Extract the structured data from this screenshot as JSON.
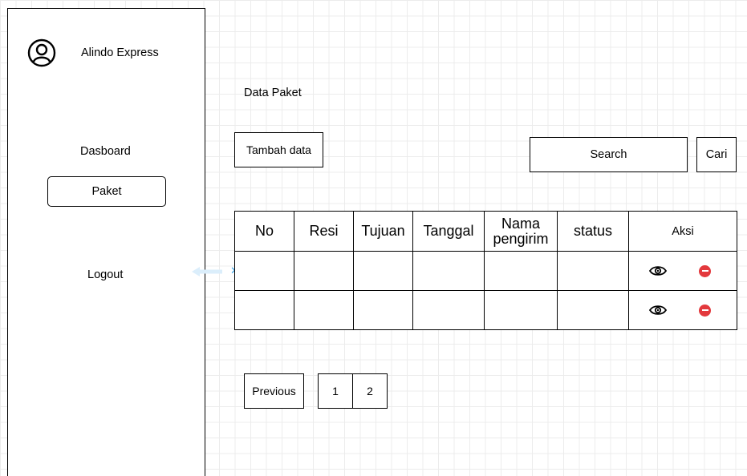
{
  "sidebar": {
    "app_name": "Alindo Express",
    "avatar_icon": "user-circle-icon",
    "items": [
      {
        "label": "Dasboard"
      },
      {
        "label": "Paket",
        "active": true
      },
      {
        "label": "Logout"
      }
    ]
  },
  "main": {
    "title": "Data Paket",
    "add_button": "Tambah data",
    "search": {
      "placeholder": "Search",
      "button": "Cari"
    },
    "table": {
      "headers": [
        "No",
        "Resi",
        "Tujuan",
        "Tanggal",
        "Nama pengirim",
        "status",
        "Aksi"
      ],
      "rows": [
        {
          "cells": [
            "",
            "",
            "",
            "",
            "",
            ""
          ],
          "actions": [
            "eye-icon",
            "delete-icon"
          ]
        },
        {
          "cells": [
            "",
            "",
            "",
            "",
            "",
            ""
          ],
          "actions": [
            "eye-icon",
            "delete-icon"
          ]
        }
      ]
    },
    "pagination": {
      "previous": "Previous",
      "pages": [
        "1",
        "2"
      ]
    }
  },
  "colors": {
    "delete": "#e3393d",
    "guide": "#3ea6e8"
  }
}
